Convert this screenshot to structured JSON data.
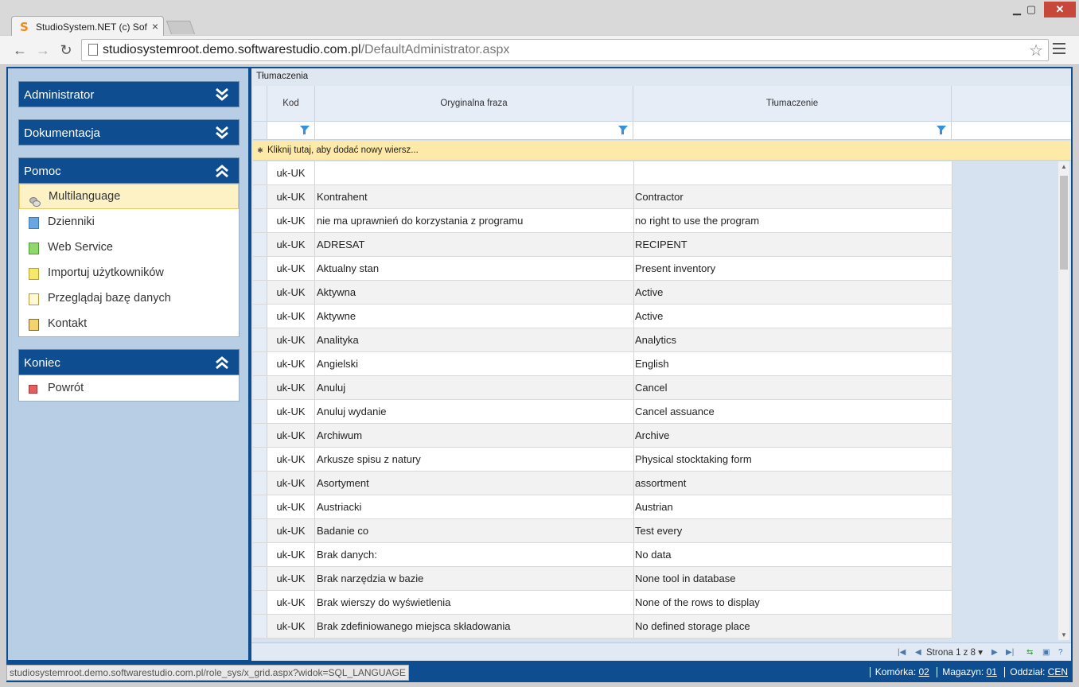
{
  "browser": {
    "tab_title": "StudioSystem.NET (c) Soft",
    "tab_close": "×",
    "url_host": "studiosystemroot.demo.softwarestudio.com.pl",
    "url_path": "/DefaultAdministrator.aspx",
    "status_url": "studiosystemroot.demo.softwarestudio.com.pl/role_sys/x_grid.aspx?widok=SQL_LANGUAGE"
  },
  "sidebar": {
    "panels": [
      {
        "title": "Administrator",
        "state": "collapsed"
      },
      {
        "title": "Dokumentacja",
        "state": "collapsed"
      },
      {
        "title": "Pomoc",
        "state": "expanded",
        "items": [
          {
            "label": "Multilanguage",
            "icon": "translate-icon",
            "active": true
          },
          {
            "label": "Dzienniki",
            "icon": "blue-document-icon"
          },
          {
            "label": "Web Service",
            "icon": "green-document-icon"
          },
          {
            "label": "Importuj użytkowników",
            "icon": "yellow-document-icon"
          },
          {
            "label": "Przeglądaj bazę danych",
            "icon": "note-icon"
          },
          {
            "label": "Kontakt",
            "icon": "contact-icon"
          }
        ]
      },
      {
        "title": "Koniec",
        "state": "expanded",
        "items": [
          {
            "label": "Powrót",
            "icon": "stop-icon"
          }
        ]
      }
    ]
  },
  "grid": {
    "caption": "Tłumaczenia",
    "columns": [
      "Kod",
      "Oryginalna fraza",
      "Tłumaczenie"
    ],
    "add_row": "Kliknij tutaj, aby dodać nowy wiersz...",
    "rows": [
      [
        "uk-UK",
        "",
        ""
      ],
      [
        "uk-UK",
        "Kontrahent",
        "Contractor"
      ],
      [
        "uk-UK",
        "nie ma uprawnień do korzystania z programu",
        "no right to use the program"
      ],
      [
        "uk-UK",
        "ADRESAT",
        "RECIPENT"
      ],
      [
        "uk-UK",
        "Aktualny stan",
        "Present inventory"
      ],
      [
        "uk-UK",
        "Aktywna",
        "Active"
      ],
      [
        "uk-UK",
        "Aktywne",
        "Active"
      ],
      [
        "uk-UK",
        "Analityka",
        "Analytics"
      ],
      [
        "uk-UK",
        "Angielski",
        "English"
      ],
      [
        "uk-UK",
        "Anuluj",
        "Cancel"
      ],
      [
        "uk-UK",
        "Anuluj wydanie",
        "Cancel assuance"
      ],
      [
        "uk-UK",
        "Archiwum",
        "Archive"
      ],
      [
        "uk-UK",
        "Arkusze spisu z natury",
        "Physical stocktaking form"
      ],
      [
        "uk-UK",
        "Asortyment",
        "assortment"
      ],
      [
        "uk-UK",
        "Austriacki",
        "Austrian"
      ],
      [
        "uk-UK",
        "Badanie co",
        "Test every"
      ],
      [
        "uk-UK",
        "Brak danych:",
        "No data"
      ],
      [
        "uk-UK",
        "Brak narzędzia w bazie",
        "None tool in database"
      ],
      [
        "uk-UK",
        "Brak wierszy do wyświetlenia",
        "None of the rows to display"
      ],
      [
        "uk-UK",
        "Brak zdefiniowanego miejsca składowania",
        "No defined storage place"
      ]
    ],
    "pager_text": "Strona 1 z 8"
  },
  "status": {
    "komorka_label": "Komórka:",
    "komorka": "02",
    "magazyn_label": "Magazyn:",
    "magazyn": "01",
    "oddzial_label": "Oddział:",
    "oddzial": "CEN"
  }
}
